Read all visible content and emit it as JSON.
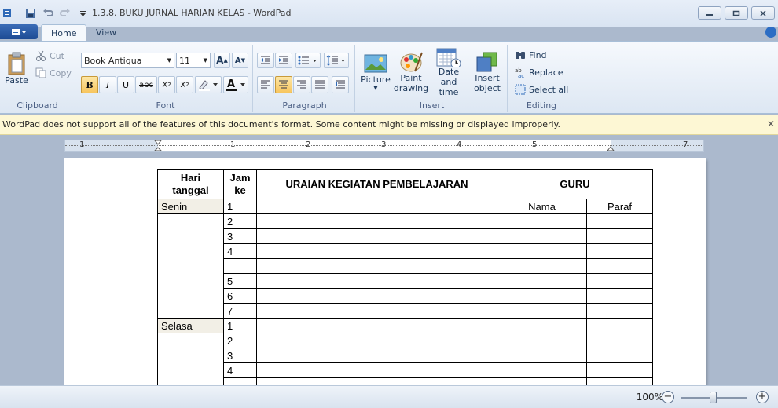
{
  "window": {
    "title": "1.3.8. BUKU JURNAL HARIAN  KELAS - WordPad"
  },
  "tabs": [
    {
      "label": "Home"
    },
    {
      "label": "View"
    }
  ],
  "clipboard": {
    "group_label": "Clipboard",
    "paste": "Paste",
    "cut": "Cut",
    "copy": "Copy"
  },
  "font": {
    "group_label": "Font",
    "family": "Book Antiqua",
    "size": "11"
  },
  "paragraph": {
    "group_label": "Paragraph"
  },
  "insert": {
    "group_label": "Insert",
    "picture": "Picture",
    "paint_drawing_1": "Paint",
    "paint_drawing_2": "drawing",
    "date_time_1": "Date and",
    "date_time_2": "time",
    "insert_object_1": "Insert",
    "insert_object_2": "object"
  },
  "editing": {
    "group_label": "Editing",
    "find": "Find",
    "replace": "Replace",
    "select_all": "Select all"
  },
  "infobar": {
    "message": "WordPad does not support all of the features of this document's format. Some content might be missing or displayed improperly."
  },
  "ruler": {
    "marks": [
      "1",
      "1",
      "2",
      "3",
      "4",
      "5",
      "7"
    ]
  },
  "table": {
    "headers": {
      "hari": "Hari tanggal",
      "jam": "Jam ke",
      "uraian": "URAIAN KEGIATAN PEMBELAJARAN",
      "guru": "GURU",
      "nama": "Nama",
      "paraf": "Paraf"
    },
    "days": [
      {
        "name": "Senin",
        "jams": [
          "1",
          "2",
          "3",
          "4",
          "",
          "5",
          "6",
          "7"
        ]
      },
      {
        "name": "Selasa",
        "jams": [
          "1",
          "2",
          "3",
          "4",
          ""
        ]
      }
    ]
  },
  "status": {
    "zoom": "100%"
  }
}
